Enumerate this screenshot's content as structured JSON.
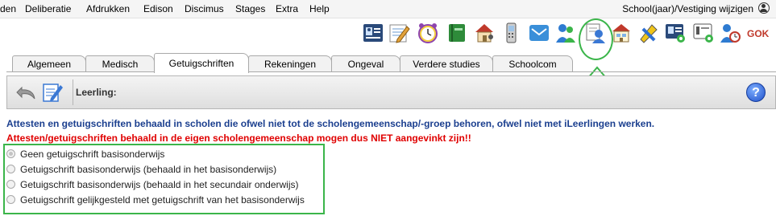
{
  "menu": {
    "items": [
      "den",
      "Deliberatie",
      "Afdrukken",
      "Edison",
      "Discimus",
      "Stages",
      "Extra",
      "Help"
    ],
    "right_label": "School(jaar)/Vestiging wijzigen"
  },
  "toolbar": {
    "icons": [
      "id-card-icon",
      "notepad-pencil-icon",
      "alarm-clock-icon",
      "green-book-icon",
      "house-person-icon",
      "mobile-phone-icon",
      "envelope-icon",
      "users-icon",
      "certificates-icon",
      "house-document-icon",
      "tools-icon",
      "id-card-gear-icon",
      "id-card-settings-icon",
      "person-clock-icon",
      "gok-icon"
    ],
    "gok_label": "GOK"
  },
  "tabs": [
    {
      "label": "Algemeen",
      "active": false
    },
    {
      "label": "Medisch",
      "active": false
    },
    {
      "label": "Getuigschriften",
      "active": true
    },
    {
      "label": "Rekeningen",
      "active": false
    },
    {
      "label": "Ongeval",
      "active": false
    },
    {
      "label": "Verdere studies",
      "active": false
    },
    {
      "label": "Schoolcom",
      "active": false
    }
  ],
  "panel": {
    "leerling_label": "Leerling:",
    "help_label": "?"
  },
  "info": {
    "blue_text": "Attesten en getuigschriften behaald in scholen die ofwel niet tot de scholengemeenschap/-groep behoren, ofwel niet met iLeerlingen werken.",
    "red_text": "Attesten/getuigschriften behaald in de eigen scholengemeenschap mogen dus NIET aangevinkt zijn!!"
  },
  "options": [
    {
      "label": "Geen getuigschrift basisonderwijs",
      "checked": true
    },
    {
      "label": "Getuigschrift basisonderwijs (behaald in het basisonderwijs)",
      "checked": false
    },
    {
      "label": "Getuigschrift basisonderwijs (behaald in het secundair onderwijs)",
      "checked": false
    },
    {
      "label": "Getuigschrift gelijkgesteld met getuigschrift van het basisonderwijs",
      "checked": false
    }
  ],
  "colors": {
    "highlight_green": "#3bb54a",
    "info_blue": "#1b3f8f",
    "warning_red": "#e00000"
  }
}
